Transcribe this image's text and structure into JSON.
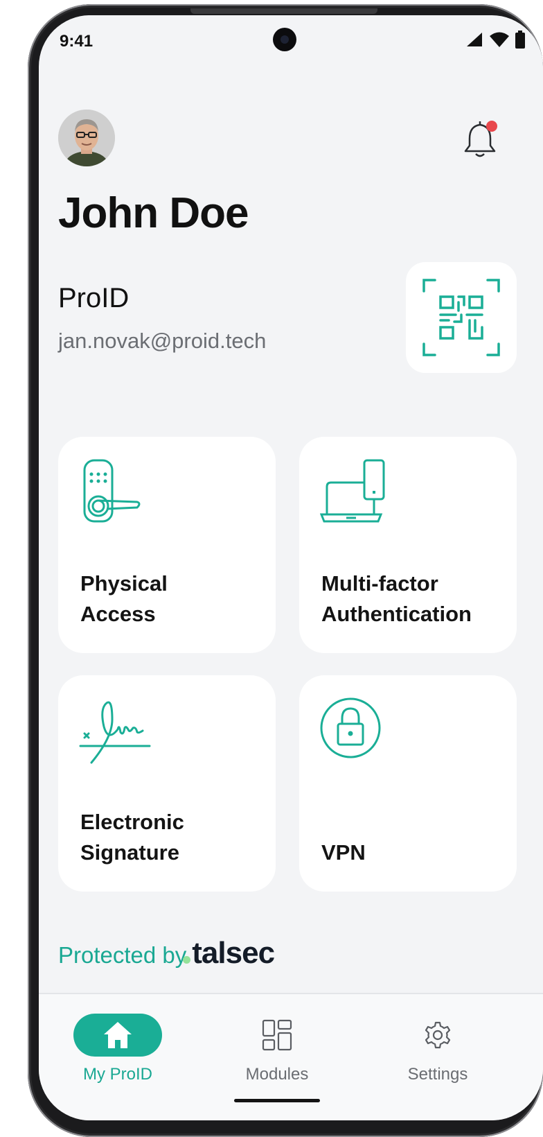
{
  "status_bar": {
    "time": "9:41"
  },
  "profile": {
    "name": "John Doe",
    "org": "ProID",
    "email": "jan.novak@proid.tech"
  },
  "cards": [
    {
      "label": "Physical\nAccess",
      "icon": "door-lock-icon"
    },
    {
      "label": "Multi-factor\nAuthentication",
      "icon": "devices-icon"
    },
    {
      "label": "Electronic\nSignature",
      "icon": "signature-icon"
    },
    {
      "label": "VPN",
      "icon": "padlock-icon"
    }
  ],
  "footer": {
    "protected_by": "Protected by",
    "brand": "talsec"
  },
  "tabs": [
    {
      "label": "My ProID",
      "icon": "home-icon",
      "active": true
    },
    {
      "label": "Modules",
      "icon": "modules-icon",
      "active": false
    },
    {
      "label": "Settings",
      "icon": "gear-icon",
      "active": false
    }
  ],
  "colors": {
    "accent": "#1aae96",
    "notification_dot": "#e8474c",
    "background": "#f3f4f6"
  }
}
